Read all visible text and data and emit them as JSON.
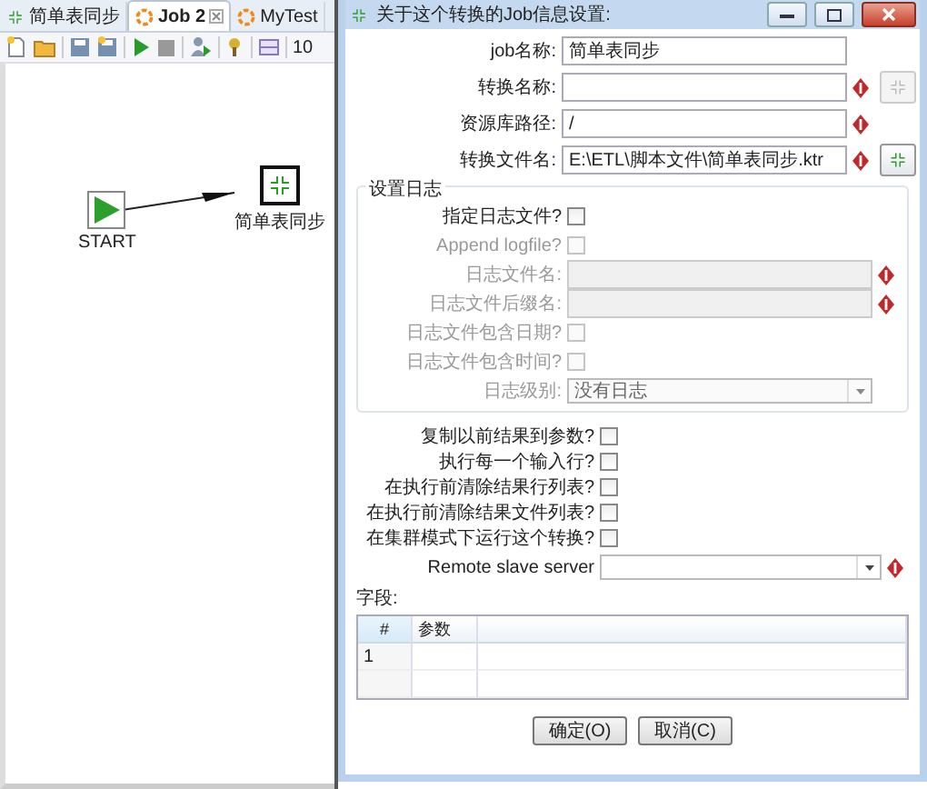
{
  "editor_tabs": [
    {
      "label": "简单表同步",
      "selected": false,
      "closable": false
    },
    {
      "label": "Job 2",
      "selected": true,
      "closable": true
    },
    {
      "label": "MyTest",
      "selected": false,
      "closable": false
    }
  ],
  "toolbar": {
    "zoom_text": "10"
  },
  "canvas": {
    "nodes": [
      {
        "label": "START",
        "kind": "start"
      },
      {
        "label": "简单表同步",
        "kind": "transform"
      }
    ]
  },
  "dialog": {
    "title": "关于这个转换的Job信息设置:",
    "fields": [
      {
        "label": "job名称:",
        "value": "简单表同步",
        "required": false
      },
      {
        "label": "转换名称:",
        "required": true,
        "browse_button": {
          "disabled": true
        }
      },
      {
        "label": "资源库路径:",
        "value": "/",
        "required": true
      },
      {
        "label": "转换文件名:",
        "value": "E:\\ETL\\脚本文件\\简单表同步.ktr",
        "required": true,
        "browse_button": {
          "disabled": false
        }
      }
    ],
    "log_group": {
      "title": "设置日志",
      "rows": [
        {
          "kind": "checkbox",
          "label": "指定日志文件?",
          "checked": false,
          "disabled": false
        },
        {
          "kind": "checkbox",
          "label": "Append logfile?",
          "checked": false,
          "disabled": true
        },
        {
          "kind": "text",
          "label": "日志文件名:",
          "disabled": true,
          "required": true
        },
        {
          "kind": "text",
          "label": "日志文件后缀名:",
          "disabled": true,
          "required": true
        },
        {
          "kind": "checkbox",
          "label": "日志文件包含日期?",
          "checked": false,
          "disabled": true
        },
        {
          "kind": "checkbox",
          "label": "日志文件包含时间?",
          "checked": false,
          "disabled": true
        },
        {
          "kind": "select",
          "label": "日志级别:",
          "value": "没有日志",
          "disabled": true
        }
      ]
    },
    "options": [
      {
        "label": "复制以前结果到参数?",
        "checked": false
      },
      {
        "label": "执行每一个输入行?",
        "checked": false
      },
      {
        "label": "在执行前清除结果行列表?",
        "checked": false
      },
      {
        "label": "在执行前清除结果文件列表?",
        "checked": false
      },
      {
        "label": "在集群模式下运行这个转换?",
        "checked": false
      }
    ],
    "remote": {
      "label": "Remote slave server",
      "required": true
    },
    "table": {
      "label": "字段:",
      "columns": [
        "#",
        "参数"
      ],
      "rows": [
        [
          "1",
          ""
        ]
      ]
    },
    "buttons": [
      "确定(O)",
      "取消(C)"
    ]
  }
}
